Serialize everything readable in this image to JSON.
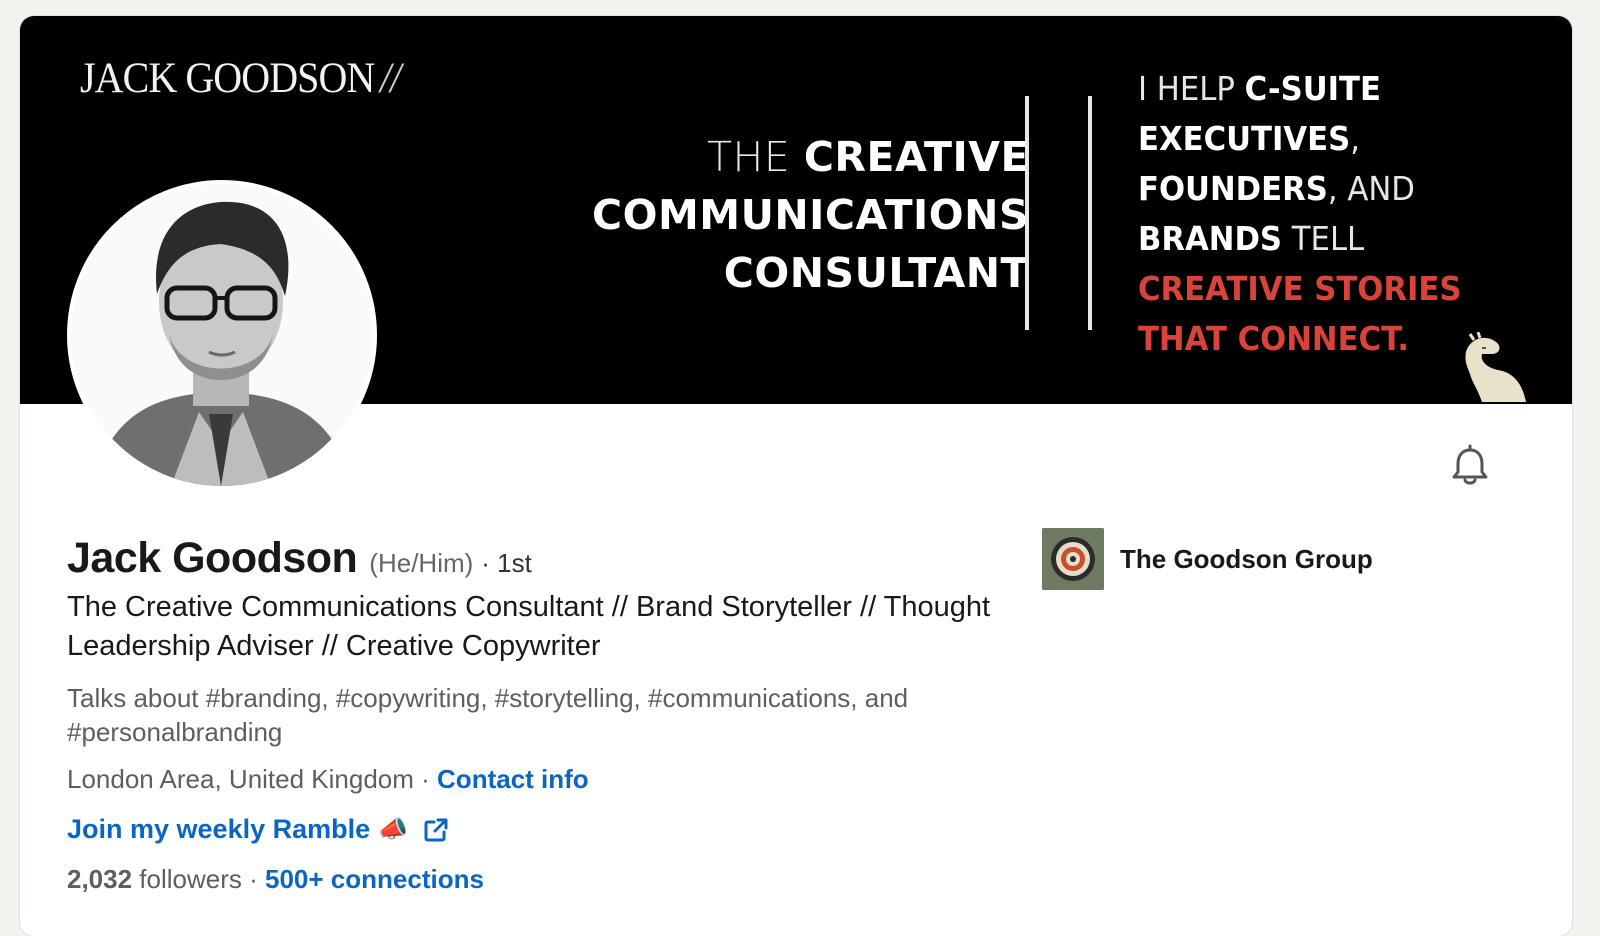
{
  "banner": {
    "brand_mark": "JACK GOODSON",
    "brand_slashes": "//",
    "tagline_1_light": "THE ",
    "tagline_1_bold": "CREATIVE",
    "tagline_2": "COMMUNICATIONS",
    "tagline_3": "CONSULTANT",
    "pitch_1_light": "I HELP ",
    "pitch_1_bold": "C-SUITE",
    "pitch_2_bold": "EXECUTIVES",
    "pitch_2_light": ",",
    "pitch_3_bold": "FOUNDERS",
    "pitch_3_light": ", AND",
    "pitch_4_bold": "BRANDS",
    "pitch_4_light": " TELL",
    "pitch_5_red": "CREATIVE STORIES",
    "pitch_6_red": "THAT CONNECT.",
    "accent_red": "#d9433a"
  },
  "profile": {
    "name": "Jack Goodson",
    "pronouns": "(He/Him)",
    "degree": "· 1st",
    "headline": "The Creative Communications Consultant // Brand Storyteller // Thought Leadership Adviser // Creative Copywriter",
    "talks_about": "Talks about #branding, #copywriting, #storytelling, #communications, and #personalbranding",
    "location": "London Area, United Kingdom",
    "location_sep": " · ",
    "contact_info": "Contact info",
    "ramble_link": "Join my weekly Ramble",
    "ramble_emoji": "📣",
    "followers_count": "2,032",
    "followers_label": " followers",
    "connections_sep": "  · ",
    "connections": "500+ connections"
  },
  "company": {
    "name": "The Goodson Group"
  },
  "icons": {
    "bell": "bell-icon",
    "external_link": "external-link-icon",
    "megaphone": "megaphone-icon"
  },
  "colors": {
    "link": "#0a66c2",
    "text": "#191919",
    "muted": "#5e5e5e"
  }
}
